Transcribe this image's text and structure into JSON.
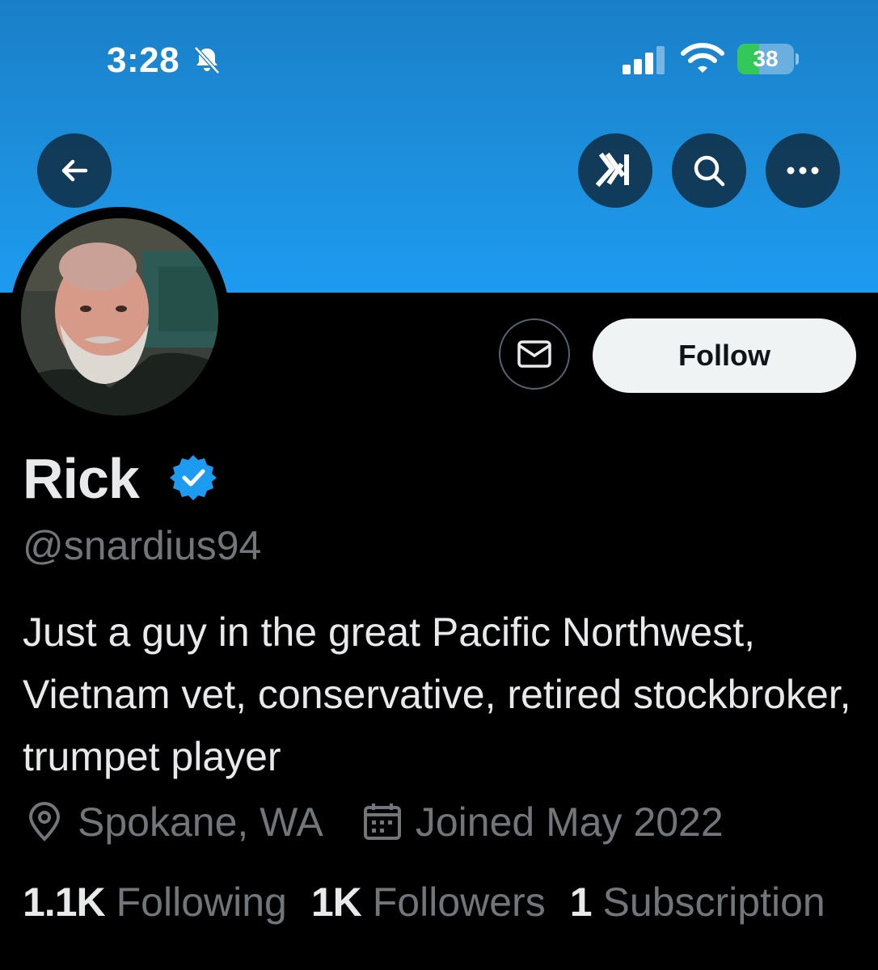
{
  "status_bar": {
    "time": "3:28",
    "battery_level": "38",
    "battery_fraction": 0.38,
    "icons": [
      "bell-slash-icon",
      "signal-icon",
      "wifi-icon",
      "battery-charging-icon"
    ]
  },
  "header": {
    "icons": [
      "arrow-left-icon",
      "grok-icon",
      "search-icon",
      "more-icon"
    ],
    "banner_color": "#1d9bf0"
  },
  "profile": {
    "name": "Rick",
    "handle": "@snardius94",
    "bio": "Just a guy in the great Pacific Northwest, Vietnam vet, conservative, retired stockbroker, trumpet player",
    "location": "Spokane, WA",
    "joined": "Joined May 2022",
    "verified_color": "#1d9bf0"
  },
  "actions": {
    "follow_label": "Follow",
    "message_icon": "envelope-icon"
  },
  "stats": {
    "following_count": "1.1K",
    "following_label": "Following",
    "followers_count": "1K",
    "followers_label": "Followers",
    "subscriptions_count": "1",
    "subscriptions_label": "Subscription"
  }
}
